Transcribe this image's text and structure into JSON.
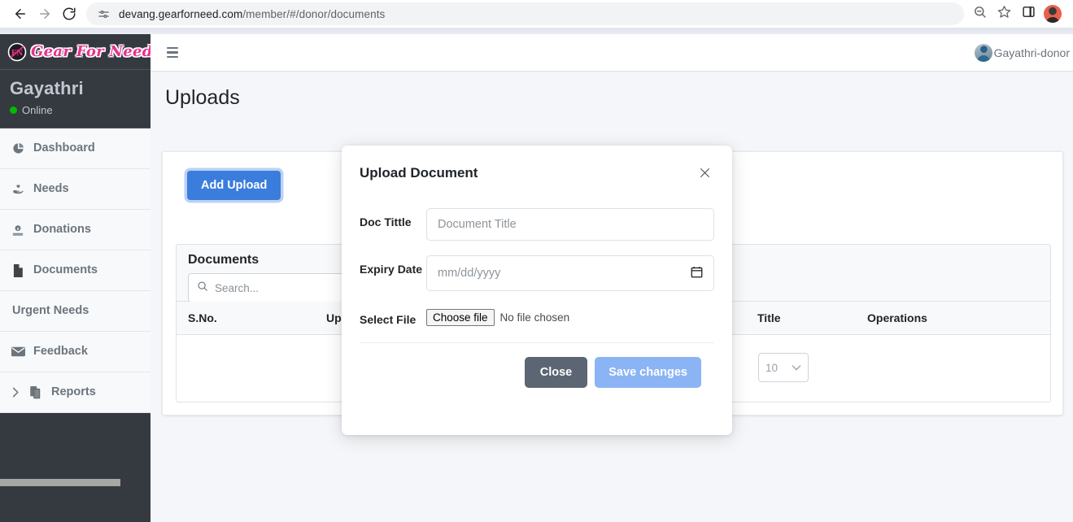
{
  "browser": {
    "url_host": "devang.gearforneed.com",
    "url_path": "/member/#/donor/documents",
    "back_icon": "back-arrow-icon",
    "forward_icon": "forward-arrow-icon",
    "reload_icon": "reload-icon",
    "site_info_icon": "site-settings-icon",
    "zoom_icon": "zoom-out-icon",
    "bookmark_icon": "star-icon",
    "side_panel_icon": "side-panel-icon",
    "profile_icon": "profile-avatar-icon"
  },
  "sidebar": {
    "brand": "Gear For Need",
    "brand_logo": "gear-for-need-logo",
    "user_name": "Gayathri",
    "status": "Online",
    "status_color": "#00bc00",
    "items": [
      {
        "label": "Dashboard",
        "icon": "pie-chart-icon",
        "name": "dashboard"
      },
      {
        "label": "Needs",
        "icon": "hand-heart-icon",
        "name": "needs"
      },
      {
        "label": "Donations",
        "icon": "donation-icon",
        "name": "donations"
      },
      {
        "label": "Documents",
        "icon": "file-icon",
        "name": "documents"
      },
      {
        "label": "Urgent Needs",
        "icon": "",
        "name": "urgent-needs"
      },
      {
        "label": "Feedback",
        "icon": "envelope-icon",
        "name": "feedback"
      },
      {
        "label": "Reports",
        "icon": "copy-files-icon",
        "name": "reports",
        "chevron": "chevron-right-icon"
      }
    ]
  },
  "topbar": {
    "menu_icon": "hamburger-menu-icon",
    "user_label": "Gayathri-donor",
    "avatar_icon": "user-avatar-icon"
  },
  "main": {
    "page_title": "Uploads",
    "add_upload_label": "Add Upload",
    "accent_color": "#3b7ddd"
  },
  "table": {
    "title": "Documents",
    "search_placeholder": "Search...",
    "search_icon": "search-icon",
    "columns": [
      "S.No.",
      "Uploaded Date",
      "Title",
      "Operations"
    ],
    "rows": [],
    "page_length": "10",
    "page_length_chevron": "chevron-down-icon"
  },
  "modal": {
    "title": "Upload Document",
    "close_icon": "close-x-icon",
    "fields": [
      {
        "label": "Doc Tittle",
        "placeholder": "Document Title",
        "value": "",
        "type": "text"
      },
      {
        "label": "Expiry Date",
        "placeholder": "mm/dd/yyyy",
        "value": "",
        "type": "date",
        "icon": "calendar-icon"
      },
      {
        "label": "Select File",
        "button": "Choose file",
        "status": "No file chosen",
        "type": "file"
      }
    ],
    "close_label": "Close",
    "save_label": "Save changes",
    "close_btn_color": "#5c6573",
    "save_btn_color": "#8bb4f5"
  }
}
